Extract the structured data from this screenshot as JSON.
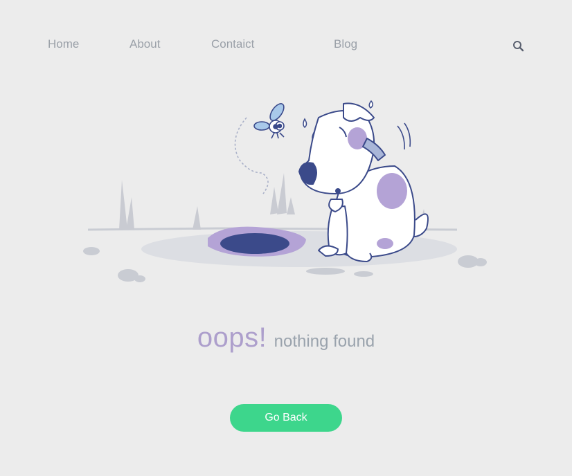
{
  "nav": {
    "items": [
      {
        "label": "Home"
      },
      {
        "label": "About"
      },
      {
        "label": "Contaict"
      },
      {
        "label": "Blog"
      }
    ],
    "search_icon": "search-icon"
  },
  "message": {
    "headline": "oops!",
    "subline": "nothing found"
  },
  "actions": {
    "go_back_label": "Go Back"
  },
  "colors": {
    "background": "#ececec",
    "nav_text": "#9aa0a8",
    "headline": "#ad9fcc",
    "subline": "#9aa3ad",
    "button": "#3dd68c",
    "button_text": "#ffffff",
    "illustration_outline": "#3b4a8a",
    "illustration_spots": "#b4a3d6"
  }
}
